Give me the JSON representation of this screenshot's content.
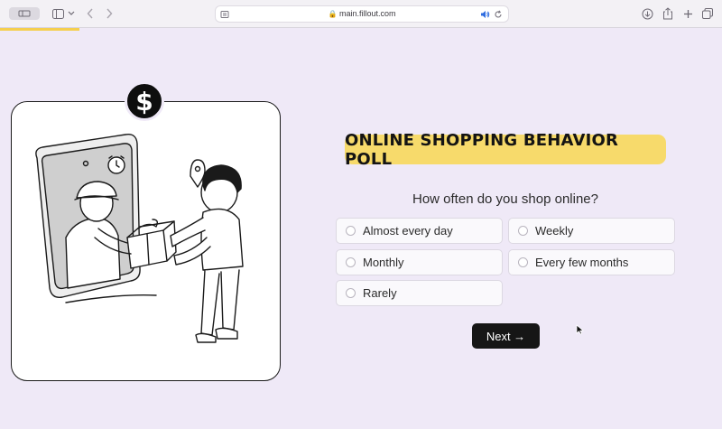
{
  "browser": {
    "url": "main.fillout.com"
  },
  "poll": {
    "title": "ONLINE SHOPPING BEHAVIOR POLL",
    "question": "How often do you shop online?",
    "options": [
      "Almost every day",
      "Weekly",
      "Monthly",
      "Every few months",
      "Rarely"
    ],
    "next_label": "Next →",
    "progress_percent": 11
  },
  "icons": {
    "badge": "dollar-icon",
    "next": "arrow-right-icon"
  },
  "colors": {
    "background": "#efe9f7",
    "title_highlight": "#f7da6b",
    "progress": "#f5cf4e",
    "button": "#161616"
  }
}
